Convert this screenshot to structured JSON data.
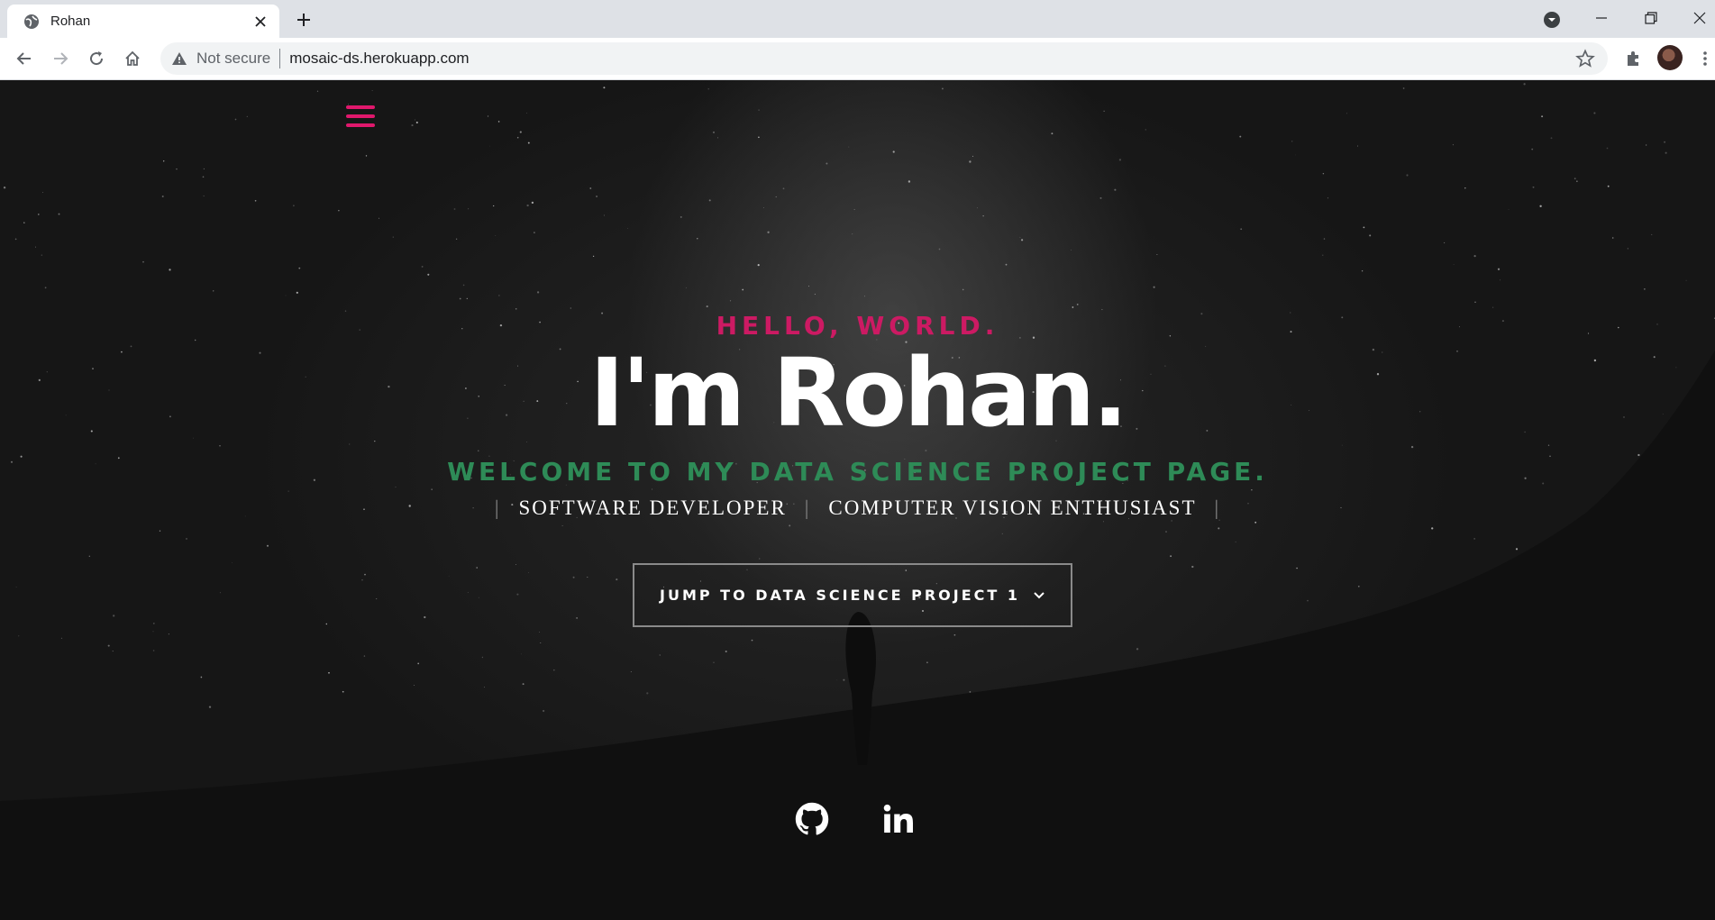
{
  "browser": {
    "tab_title": "Rohan",
    "security_label": "Not secure",
    "url": "mosaic-ds.herokuapp.com"
  },
  "hero": {
    "greeting": "HELLO, WORLD.",
    "name": "I'm Rohan.",
    "tagline": "WELCOME TO MY DATA SCIENCE PROJECT PAGE.",
    "roles": [
      "SOFTWARE DEVELOPER",
      "COMPUTER VISION ENTHUSIAST"
    ],
    "role_separator": "|",
    "cta_label": "JUMP TO DATA SCIENCE PROJECT 1"
  },
  "social": [
    {
      "icon": "github-icon"
    },
    {
      "icon": "linkedin-icon"
    }
  ],
  "colors": {
    "accent_pink": "#cc1a63",
    "accent_green": "#2e8b57",
    "page_bg": "#161616"
  }
}
